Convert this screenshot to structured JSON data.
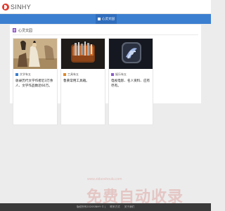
{
  "header": {
    "logo_text": "SINHY"
  },
  "nav": {
    "active_tab": "心灵文园"
  },
  "section": {
    "title": "心灵文园"
  },
  "cards": [
    {
      "category": "文学有五",
      "description": "收录历代文学作者近3万余人、文学作品数近60万。",
      "icon": "book-icon"
    },
    {
      "category": "工具有五",
      "description": "鲁黄常用工具箱。",
      "icon": "tool-icon"
    },
    {
      "category": "娱乐有五",
      "description": "电视电影、名人资料、应有尽有。",
      "icon": "play-icon"
    }
  ],
  "footer": {
    "copyright": "版权所有2020SINHY © |",
    "contact": "联系方式",
    "about": "关于我们"
  },
  "watermark": {
    "text": "免费自动收录",
    "url": "www.ziduoshoulu.com"
  },
  "colors": {
    "nav": "#3b7fd0",
    "footer": "#3a3a3a",
    "accent": "#7b3fb5"
  }
}
